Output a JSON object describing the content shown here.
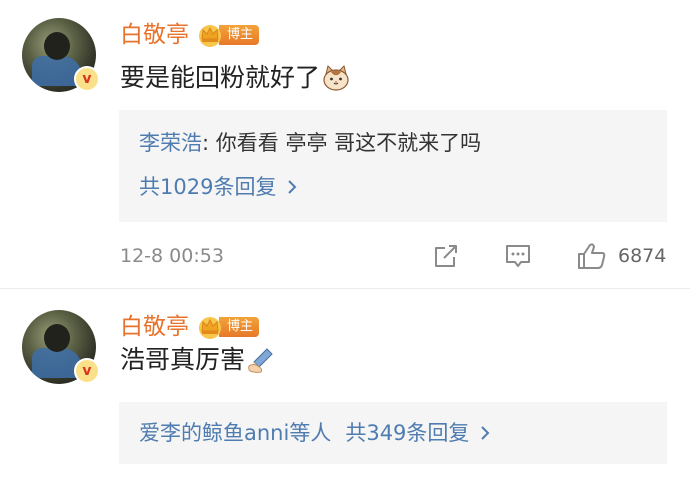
{
  "comments": [
    {
      "username": "白敬亭",
      "badge_label": "博主",
      "text": "要是能回粉就好了",
      "reply": {
        "user": "李荣浩",
        "separator": ": ",
        "text": "你看看 亭亭 哥这不就来了吗"
      },
      "more_replies": "共1029条回复",
      "timestamp": "12-8 00:53",
      "like_count": "6874"
    },
    {
      "username": "白敬亭",
      "badge_label": "博主",
      "text": "浩哥真厉害",
      "reply_summary": {
        "users": "爱李的鲸鱼anni等人",
        "count_text": "共349条回复"
      }
    }
  ],
  "colors": {
    "username": "#e8732c",
    "link": "#4f7cb0",
    "reply_bg": "#f5f5f5",
    "muted": "#8a8a8a",
    "badge": "#f2a33a"
  },
  "icons": {
    "verified": "verified-v-icon",
    "crown": "crown-icon",
    "cat_emoji": "cat-face-emoji",
    "writing_emoji": "writing-hand-emoji",
    "share": "share-icon",
    "comment": "comment-icon",
    "like": "thumbs-up-icon",
    "chevron": "chevron-right-icon"
  },
  "verified_glyph": "v"
}
